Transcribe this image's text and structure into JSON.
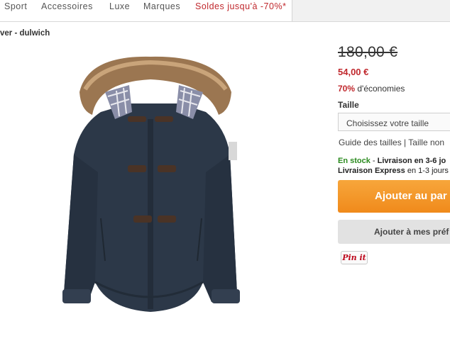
{
  "nav": {
    "items": [
      {
        "label": "Sport"
      },
      {
        "label": "Accessoires"
      },
      {
        "label": "Luxe"
      },
      {
        "label": "Marques"
      }
    ],
    "sale_label": "Soldes jusqu'à -70%*"
  },
  "breadcrumb": "ver - dulwich",
  "product": {
    "price_old": "180,00 €",
    "price_new": "54,00 €",
    "savings_percent": "70%",
    "savings_text": " d'économies",
    "size_label": "Taille",
    "size_select_value": "Choisissez votre taille",
    "size_guide_link": "Guide des tailles",
    "size_sep": " | ",
    "size_missing_link": "Taille non",
    "stock_status": "En stock",
    "stock_sep": " - ",
    "delivery_label": "Livraison en 3-6 jo",
    "express_label": "Livraison Express",
    "express_text": " en 1-3 jours",
    "add_to_cart_label": "Ajouter au par",
    "wishlist_label": "Ajouter à mes préf",
    "pinit_label": "Pin it"
  },
  "colors": {
    "accent_orange": "#f08a1b",
    "sale_red": "#c0282d",
    "stock_green": "#2a8a1e",
    "jacket_navy": "#2c3848"
  }
}
